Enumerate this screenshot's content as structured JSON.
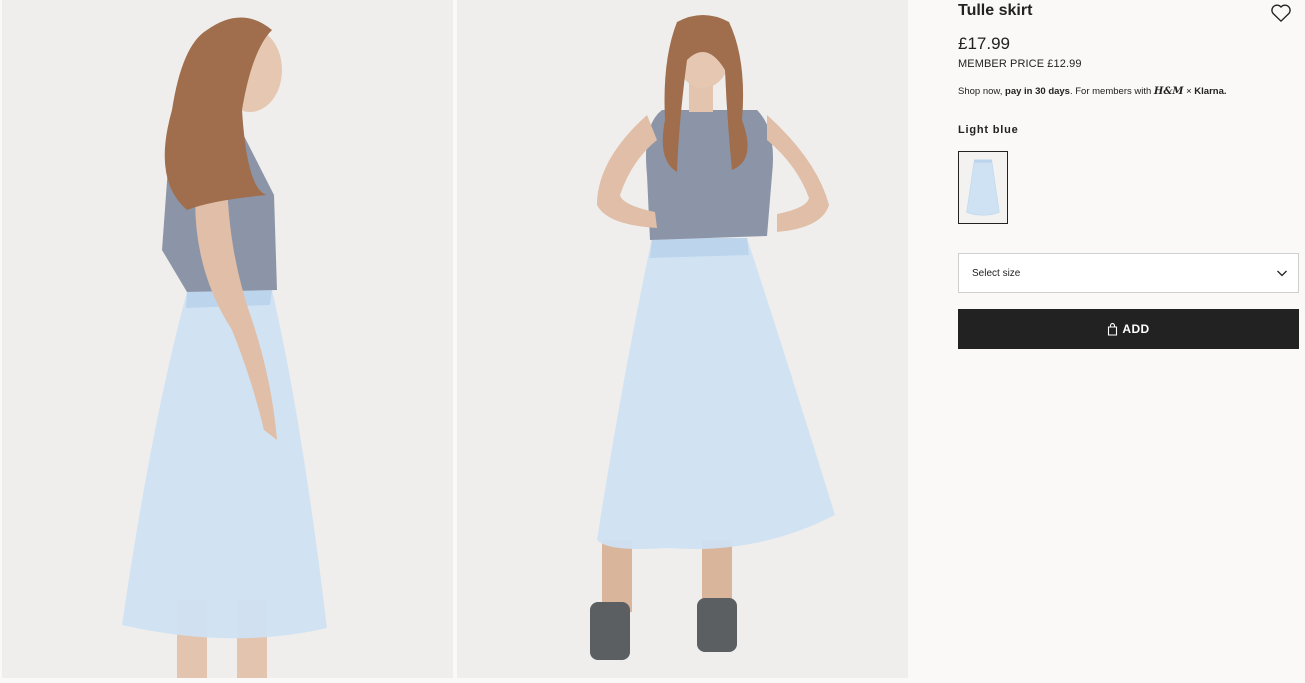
{
  "product": {
    "title": "Tulle skirt",
    "price": "£17.99",
    "member_price": "MEMBER PRICE £12.99"
  },
  "klarna": {
    "prefix": "Shop now, ",
    "bold": "pay in 30 days",
    "middle": ". For members with ",
    "brand_hm": "H&M",
    "cross": " × ",
    "brand_klarna": "Klarna."
  },
  "color": {
    "label": "Light blue",
    "swatch_color": "#cfe2f3"
  },
  "size_select": {
    "label": "Select size"
  },
  "add_button": {
    "label": "ADD"
  },
  "icons": [
    "heart-icon",
    "chevron-down-icon",
    "shopping-bag-icon"
  ],
  "colors": {
    "background": "#faf9f8",
    "button": "#222222",
    "skirt": "#cfe2f3"
  }
}
